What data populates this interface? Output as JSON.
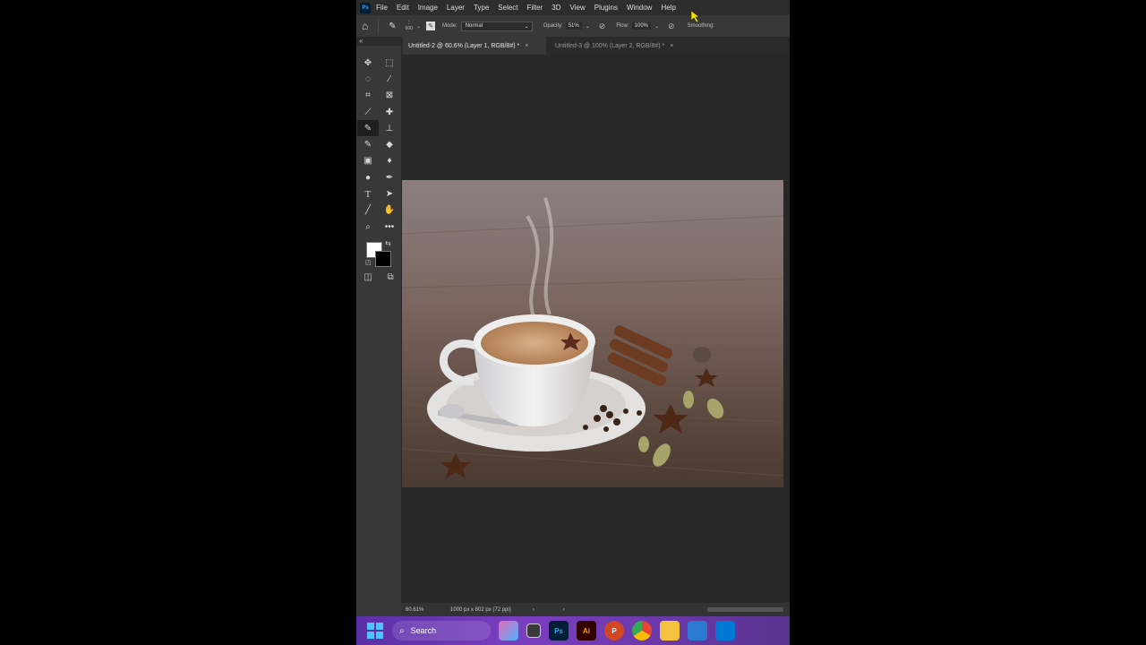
{
  "app": {
    "logo": "Ps",
    "menu": [
      "File",
      "Edit",
      "Image",
      "Layer",
      "Type",
      "Select",
      "Filter",
      "3D",
      "View",
      "Plugins",
      "Window",
      "Help"
    ]
  },
  "options": {
    "brush_size": "600",
    "mode_label": "Mode:",
    "mode_value": "Normal",
    "opacity_label": "Opacity:",
    "opacity_value": "51%",
    "flow_label": "Flow:",
    "flow_value": "100%",
    "smoothing_label": "Smoothing:"
  },
  "tabs": [
    {
      "label": "Untitled-2 @ 60.6% (Layer 1, RGB/8#) *",
      "close": "×"
    },
    {
      "label": "Untitled-3 @ 100% (Layer 2, RGB/8#) *",
      "close": "×"
    }
  ],
  "tools": [
    "move",
    "marquee",
    "lasso",
    "quick-select",
    "crop",
    "frame",
    "eyedropper",
    "healing",
    "brush",
    "stamp",
    "history-brush",
    "eraser",
    "gradient",
    "blur",
    "dodge",
    "pen",
    "type",
    "path-select",
    "line",
    "hand-rotate",
    "zoom",
    "more"
  ],
  "status": {
    "zoom": "60.61%",
    "doc_info": "1000 px x 802 px (72 ppi)",
    "arrow": "›"
  },
  "taskbar": {
    "search_label": "Search",
    "apps": [
      {
        "name": "copilot",
        "color": "#e06bb3",
        "glyph": ""
      },
      {
        "name": "task-view",
        "color": "#3a3a3a",
        "glyph": ""
      },
      {
        "name": "photoshop",
        "color": "#001e36",
        "glyph": "Ps"
      },
      {
        "name": "illustrator",
        "color": "#330000",
        "glyph": "Ai"
      },
      {
        "name": "powerpoint",
        "color": "#d24726",
        "glyph": "P"
      },
      {
        "name": "chrome",
        "color": "#4285f4",
        "glyph": ""
      },
      {
        "name": "file-explorer",
        "color": "#f5c242",
        "glyph": ""
      },
      {
        "name": "store",
        "color": "#2b7ad1",
        "glyph": ""
      },
      {
        "name": "vscode",
        "color": "#0078d4",
        "glyph": ""
      }
    ]
  },
  "colors": {
    "foreground": "#ffffff",
    "background": "#000000"
  }
}
